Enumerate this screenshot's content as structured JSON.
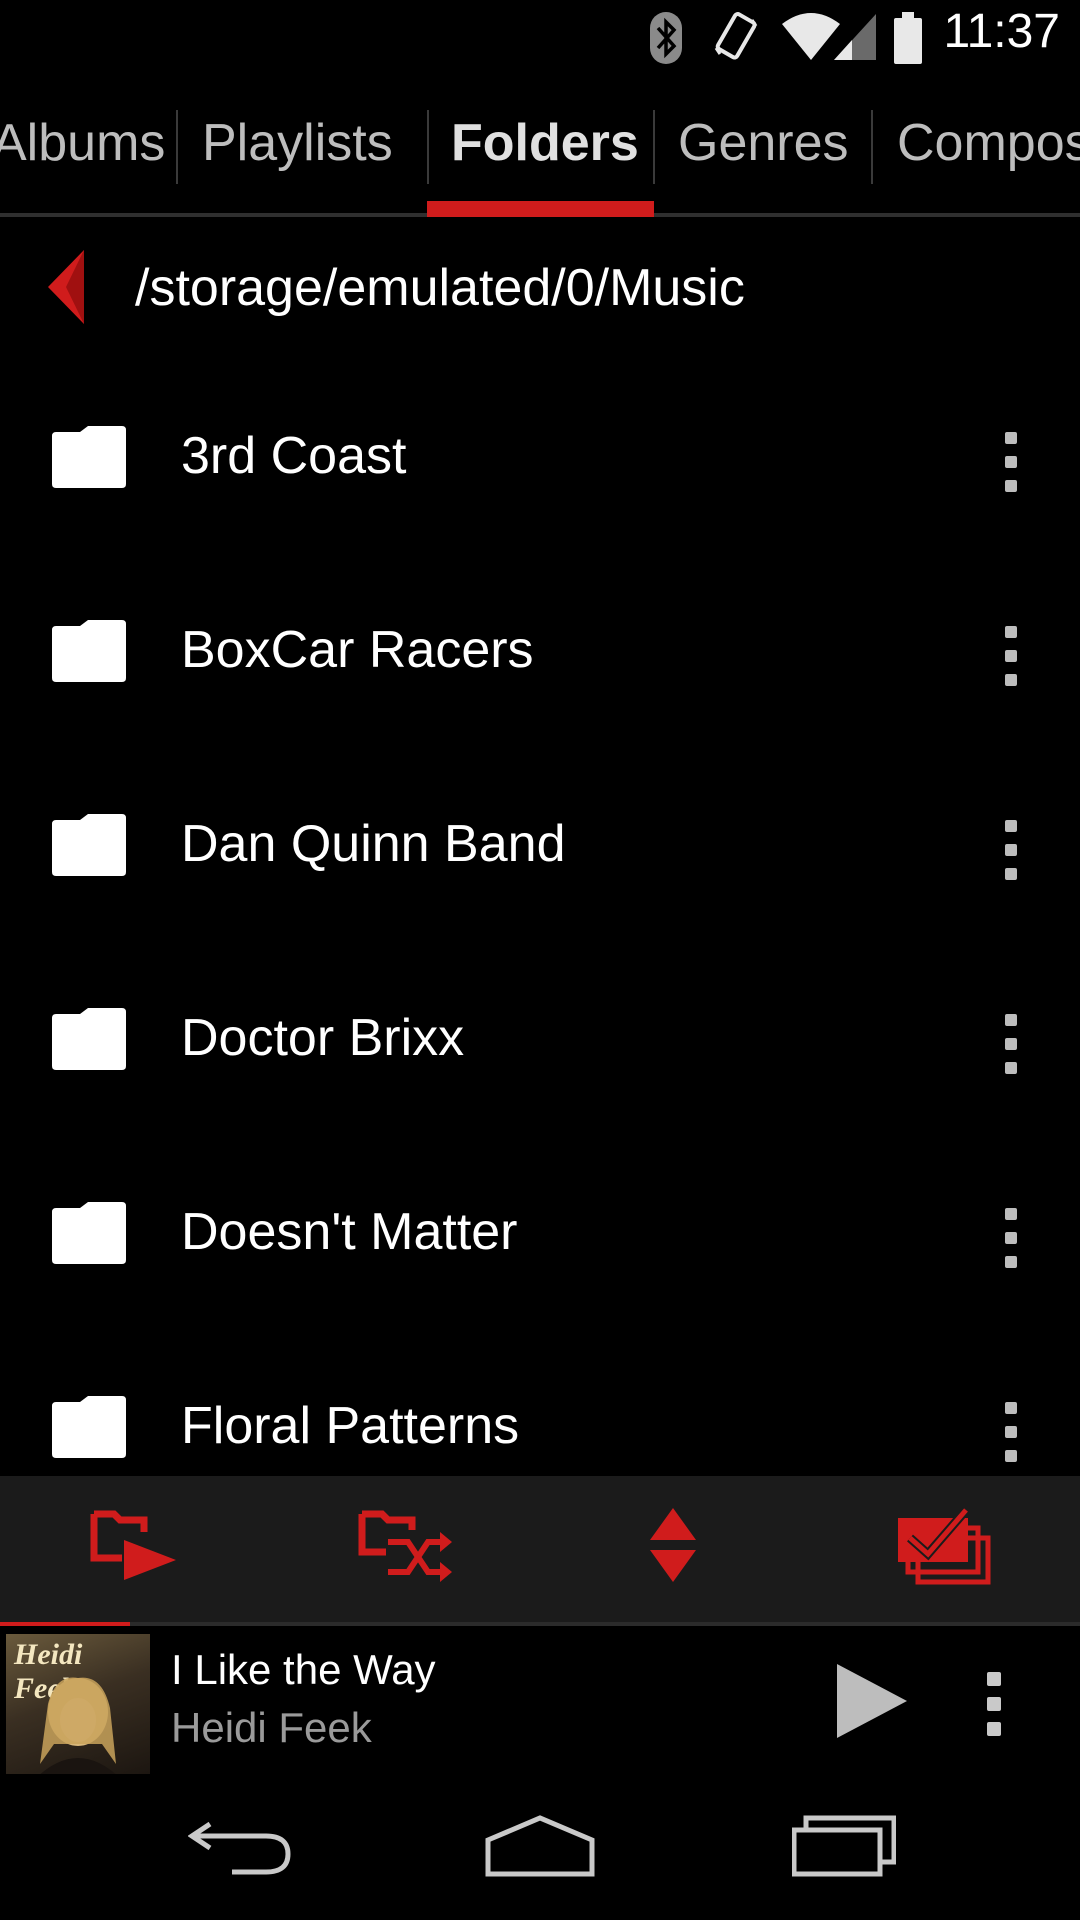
{
  "status": {
    "time": "11:37",
    "icons": [
      "bluetooth-icon",
      "vibrate-icon",
      "wifi-icon",
      "signal-icon",
      "battery-icon"
    ]
  },
  "tabs": [
    {
      "label": "Albums"
    },
    {
      "label": "Playlists"
    },
    {
      "label": "Folders",
      "active": true
    },
    {
      "label": "Genres"
    },
    {
      "label": "Composers"
    }
  ],
  "path": "/storage/emulated/0/Music",
  "folders": [
    {
      "name": "3rd Coast"
    },
    {
      "name": "BoxCar Racers"
    },
    {
      "name": "Dan Quinn Band"
    },
    {
      "name": "Doctor Brixx"
    },
    {
      "name": "Doesn't Matter"
    },
    {
      "name": "Floral Patterns"
    }
  ],
  "actions": [
    "play-folder-icon",
    "shuffle-folder-icon",
    "sort-icon",
    "multi-select-icon"
  ],
  "now_playing": {
    "title": "I Like the Way",
    "artist": "Heidi Feek",
    "album_art_text": "Heidi Feek",
    "progress": 0.12
  },
  "colors": {
    "accent": "#d01c1c",
    "background": "#000000",
    "action_bar": "#1b1b1b"
  }
}
